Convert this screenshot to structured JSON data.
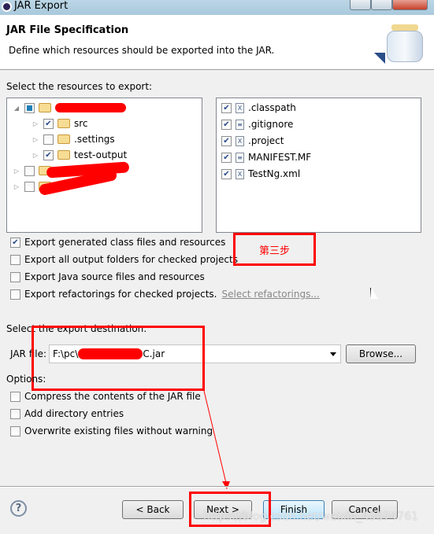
{
  "window": {
    "title": "JAR Export"
  },
  "header": {
    "title": "JAR File Specification",
    "description": "Define which resources should be exported into the JAR."
  },
  "resources": {
    "label": "Select the resources to export:",
    "tree": [
      {
        "label": "src",
        "checked": true
      },
      {
        "label": ".settings",
        "checked": false
      },
      {
        "label": "test-output",
        "checked": true
      }
    ],
    "files": [
      {
        "label": ".classpath",
        "icon": "xml-file-icon"
      },
      {
        "label": ".gitignore",
        "icon": "text-file-icon"
      },
      {
        "label": ".project",
        "icon": "xml-file-icon"
      },
      {
        "label": "MANIFEST.MF",
        "icon": "text-file-icon"
      },
      {
        "label": "TestNg.xml",
        "icon": "xml-file-icon"
      }
    ]
  },
  "export_options": [
    {
      "label": "Export generated class files and resources",
      "checked": true
    },
    {
      "label": "Export all output folders for checked projects",
      "checked": false
    },
    {
      "label": "Export Java source files and resources",
      "checked": false
    },
    {
      "label": "Export refactorings for checked projects.",
      "checked": false
    }
  ],
  "select_refactorings": "Select refactorings...",
  "annotation_step": "第三步",
  "destination": {
    "label": "Select the export destination:",
    "jar_label": "JAR file:",
    "jar_value_prefix": "F:\\pc\\",
    "jar_value_suffix": "C.jar",
    "browse": "Browse..."
  },
  "options": {
    "label": "Options:",
    "items": [
      {
        "label": "Compress the contents of the JAR file",
        "checked": false
      },
      {
        "label": "Add directory entries",
        "checked": false
      },
      {
        "label": "Overwrite existing files without warning",
        "checked": false
      }
    ]
  },
  "buttons": {
    "back": "< Back",
    "next": "Next >",
    "finish": "Finish",
    "cancel": "Cancel"
  },
  "watermark": "https://blog.csdn.net/weixin_43574761",
  "colors": {
    "annotation": "#ff0000"
  }
}
